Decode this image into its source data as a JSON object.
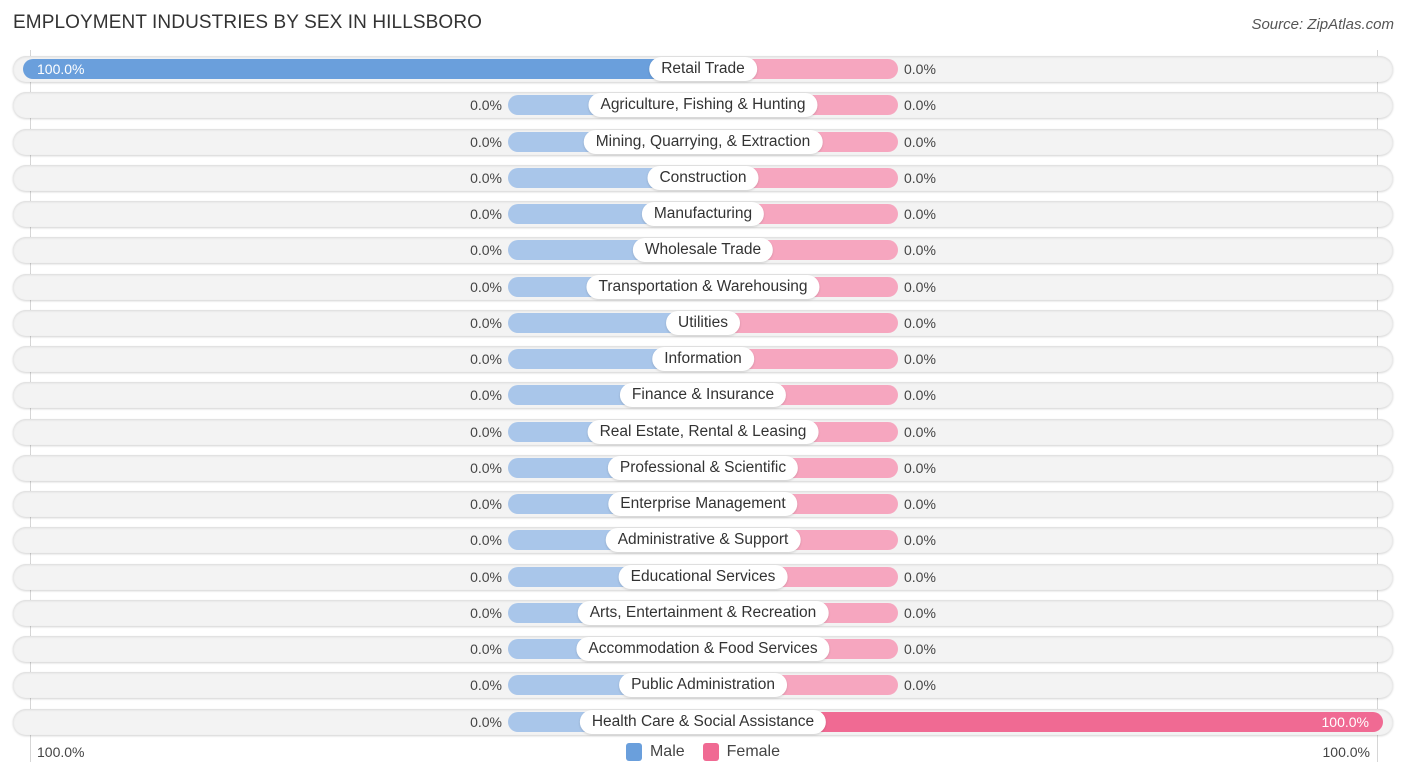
{
  "title": "EMPLOYMENT INDUSTRIES BY SEX IN HILLSBORO",
  "source": "Source: ZipAtlas.com",
  "colors": {
    "male": "#6a9fdc",
    "male_light": "#a9c6ea",
    "female": "#f06a93",
    "female_light": "#f6a6bf"
  },
  "axis": {
    "left_label": "100.0%",
    "right_label": "100.0%"
  },
  "legend": {
    "male": "Male",
    "female": "Female"
  },
  "chart_data": {
    "type": "bar",
    "orientation": "horizontal-diverging",
    "title": "EMPLOYMENT INDUSTRIES BY SEX IN HILLSBORO",
    "xlabel": "",
    "ylabel": "",
    "xlim": [
      -100,
      100
    ],
    "legend_position": "bottom-center",
    "categories": [
      "Retail Trade",
      "Agriculture, Fishing & Hunting",
      "Mining, Quarrying, & Extraction",
      "Construction",
      "Manufacturing",
      "Wholesale Trade",
      "Transportation & Warehousing",
      "Utilities",
      "Information",
      "Finance & Insurance",
      "Real Estate, Rental & Leasing",
      "Professional & Scientific",
      "Enterprise Management",
      "Administrative & Support",
      "Educational Services",
      "Arts, Entertainment & Recreation",
      "Accommodation & Food Services",
      "Public Administration",
      "Health Care & Social Assistance"
    ],
    "series": [
      {
        "name": "Male",
        "values": [
          100.0,
          0.0,
          0.0,
          0.0,
          0.0,
          0.0,
          0.0,
          0.0,
          0.0,
          0.0,
          0.0,
          0.0,
          0.0,
          0.0,
          0.0,
          0.0,
          0.0,
          0.0,
          0.0
        ],
        "labels": [
          "100.0%",
          "0.0%",
          "0.0%",
          "0.0%",
          "0.0%",
          "0.0%",
          "0.0%",
          "0.0%",
          "0.0%",
          "0.0%",
          "0.0%",
          "0.0%",
          "0.0%",
          "0.0%",
          "0.0%",
          "0.0%",
          "0.0%",
          "0.0%",
          "0.0%"
        ]
      },
      {
        "name": "Female",
        "values": [
          0.0,
          0.0,
          0.0,
          0.0,
          0.0,
          0.0,
          0.0,
          0.0,
          0.0,
          0.0,
          0.0,
          0.0,
          0.0,
          0.0,
          0.0,
          0.0,
          0.0,
          0.0,
          100.0
        ],
        "labels": [
          "0.0%",
          "0.0%",
          "0.0%",
          "0.0%",
          "0.0%",
          "0.0%",
          "0.0%",
          "0.0%",
          "0.0%",
          "0.0%",
          "0.0%",
          "0.0%",
          "0.0%",
          "0.0%",
          "0.0%",
          "0.0%",
          "0.0%",
          "0.0%",
          "100.0%"
        ]
      }
    ]
  }
}
